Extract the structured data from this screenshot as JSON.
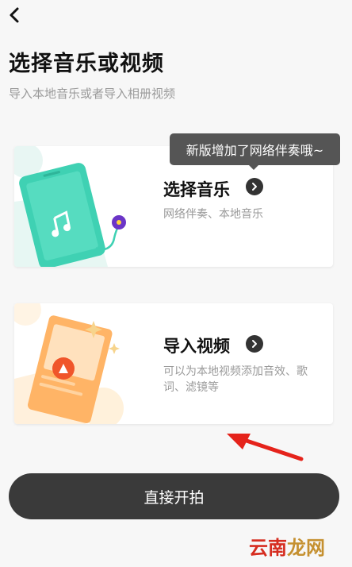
{
  "header": {
    "back_icon": "chevron-left-icon",
    "title": "选择音乐或视频",
    "subtitle": "导入本地音乐或者导入相册视频"
  },
  "music_card": {
    "title": "选择音乐",
    "description": "网络伴奏、本地音乐",
    "tooltip": "新版增加了网络伴奏哦~",
    "icon": "music-note-icon"
  },
  "video_card": {
    "title": "导入视频",
    "description": "可以为本地视频添加音效、歌词、滤镜等",
    "icon": "play-icon"
  },
  "footer": {
    "shoot_button": "直接开拍"
  },
  "watermark": {
    "part1": "云南",
    "part2": "龙网"
  },
  "colors": {
    "button_bg": "#3a3a3a",
    "phone_green": "#3fd1b3",
    "video_orange": "#ffb466",
    "annotation_red": "#e5231b"
  }
}
